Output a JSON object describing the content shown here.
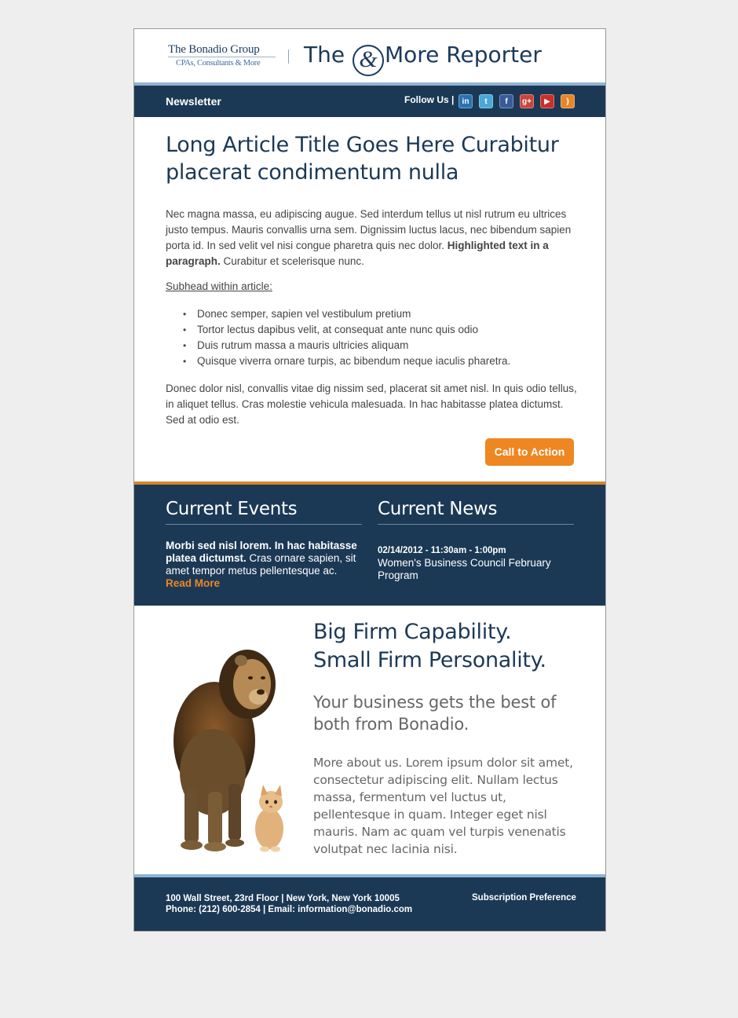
{
  "header": {
    "logo_main": "The Bonadio Group",
    "logo_sub": "CPAs, Consultants & More",
    "reporter_left": "The",
    "reporter_amp": "&",
    "reporter_right": "More Reporter"
  },
  "nav": {
    "title": "Newsletter",
    "follow_label": "Follow Us |",
    "social": [
      {
        "name": "linkedin-icon",
        "glyph": "in",
        "color": "#2a73b3"
      },
      {
        "name": "twitter-icon",
        "glyph": "t",
        "color": "#4aa8d8"
      },
      {
        "name": "facebook-icon",
        "glyph": "f",
        "color": "#3b5a9a"
      },
      {
        "name": "google-plus-icon",
        "glyph": "g+",
        "color": "#c9443a"
      },
      {
        "name": "youtube-icon",
        "glyph": "▶",
        "color": "#c8302a"
      },
      {
        "name": "rss-icon",
        "glyph": ")",
        "color": "#e5862a"
      }
    ]
  },
  "article": {
    "title": "Long Article Title Goes Here Curabitur placerat condimentum nulla",
    "para1": "Nec magna massa, eu adipiscing augue. Sed interdum tellus ut nisl rutrum eu ultrices justo tempus. Mauris convallis urna sem. Dignissim luctus lacus, nec bibendum sapien porta id. In sed velit vel nisi congue pharetra quis nec dolor.",
    "para1_bold": "Highlighted text in a paragraph.",
    "para1_tail": " Curabitur et scelerisque nunc.",
    "subhead": "Subhead within article:",
    "bullets": [
      "Donec semper, sapien vel vestibulum pretium",
      "Tortor lectus dapibus velit, at consequat ante nunc quis odio",
      "Duis rutrum massa a mauris ultricies aliquam",
      "Quisque viverra ornare turpis, ac bibendum neque iaculis pharetra."
    ],
    "para2": "Donec dolor nisl, convallis vitae dig nissim sed, placerat sit amet nisl. In quis odio tellus, in aliquet tellus. Cras molestie vehicula malesuada. In hac habitasse platea dictumst. Sed at odio est.",
    "cta": "Call to Action"
  },
  "events": {
    "heading": "Current Events",
    "bold": "Morbi sed nisl lorem. In hac habitasse platea dictumst.",
    "text": " Cras ornare sapien, sit amet tempor metus pellentesque ac. ",
    "read_more": "Read More"
  },
  "news": {
    "heading": "Current News",
    "date": "02/14/2012 - 11:30am - 1:00pm",
    "title": "Women's Business Council February Program"
  },
  "promo": {
    "headline_1": "Big Firm Capability.",
    "headline_2": "Small Firm Personality.",
    "subhead": "Your business gets the best of both from Bonadio.",
    "about": "More about us. Lorem ipsum dolor sit amet, consectetur adipiscing elit. Nullam lectus massa, fermentum vel luctus ut, pellentesque in quam. Integer eget nisl mauris. Nam ac quam vel turpis venenatis volutpat nec lacinia nisi."
  },
  "footer": {
    "address": "100 Wall Street, 23rd Floor | New York, New York 10005",
    "contact": "Phone: (212) 600-2854 | Email: information@bonadio.com",
    "subscription": "Subscription Preference"
  }
}
